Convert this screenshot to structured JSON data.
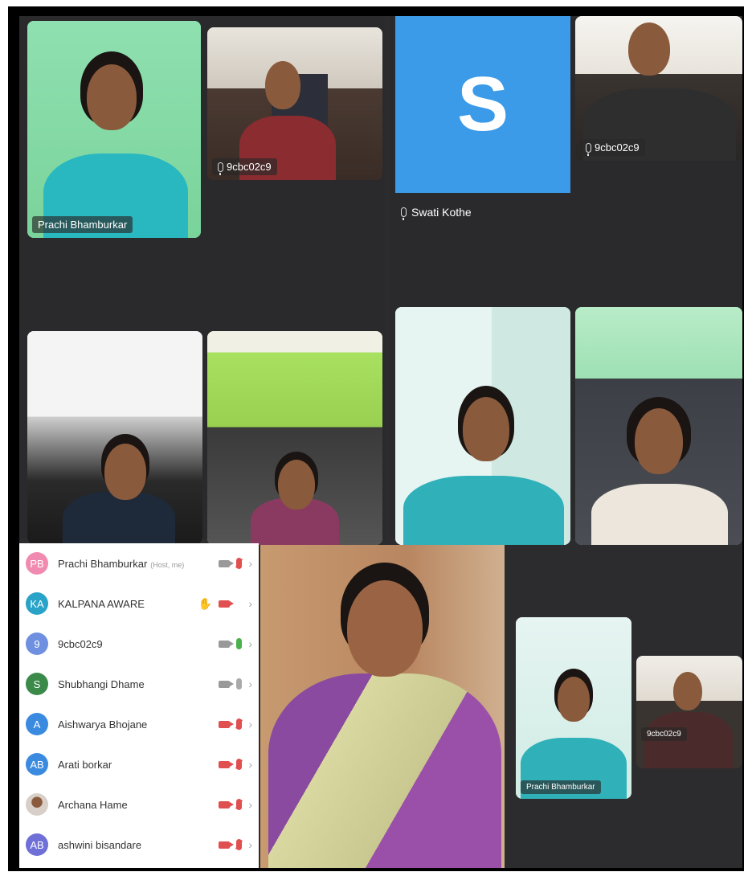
{
  "meeting": {
    "grid_top_left": [
      {
        "name": "Prachi Bhamburkar"
      },
      {
        "name": "9cbc02c9"
      },
      {
        "name": ""
      },
      {
        "name": ""
      }
    ],
    "grid_top_right": [
      {
        "name": "Swati Kothe",
        "avatar_letter": "S"
      },
      {
        "name": "9cbc02c9"
      },
      {
        "name": ""
      },
      {
        "name": ""
      }
    ],
    "speaker_tile": {
      "name": ""
    },
    "mini_tiles": [
      {
        "name": "Prachi Bhamburkar"
      },
      {
        "name": "9cbc02c9"
      }
    ]
  },
  "participants": [
    {
      "initials": "PB",
      "name": "Prachi Bhamburkar",
      "tag": "(Host, me)",
      "avatar_color": "#f08ab0",
      "cam": "on",
      "mic": "off",
      "hand": false
    },
    {
      "initials": "KA",
      "name": "KALPANA AWARE",
      "tag": "",
      "avatar_color": "#29a3c8",
      "cam": "off",
      "mic": "none",
      "hand": true
    },
    {
      "initials": "9",
      "name": "9cbc02c9",
      "tag": "",
      "avatar_color": "#6f8fe0",
      "cam": "on",
      "mic": "green",
      "hand": false
    },
    {
      "initials": "S",
      "name": "Shubhangi Dhame",
      "tag": "",
      "avatar_color": "#3b8a4a",
      "cam": "on",
      "mic": "grey",
      "hand": false
    },
    {
      "initials": "A",
      "name": "Aishwarya Bhojane",
      "tag": "",
      "avatar_color": "#3a8be0",
      "cam": "off",
      "mic": "off",
      "hand": false
    },
    {
      "initials": "AB",
      "name": "Arati borkar",
      "tag": "",
      "avatar_color": "#3a8be0",
      "cam": "off",
      "mic": "off",
      "hand": false
    },
    {
      "initials": "",
      "name": "Archana Hame",
      "tag": "",
      "avatar_color": "#7a5a48",
      "cam": "off",
      "mic": "off",
      "hand": false
    },
    {
      "initials": "AB",
      "name": "ashwini bisandare",
      "tag": "",
      "avatar_color": "#6f6fd8",
      "cam": "off",
      "mic": "off",
      "hand": false
    }
  ],
  "colors": {
    "background": "#2c2c2e",
    "tile_green": "#7ad39a",
    "avatar_blue": "#3b9be8"
  }
}
